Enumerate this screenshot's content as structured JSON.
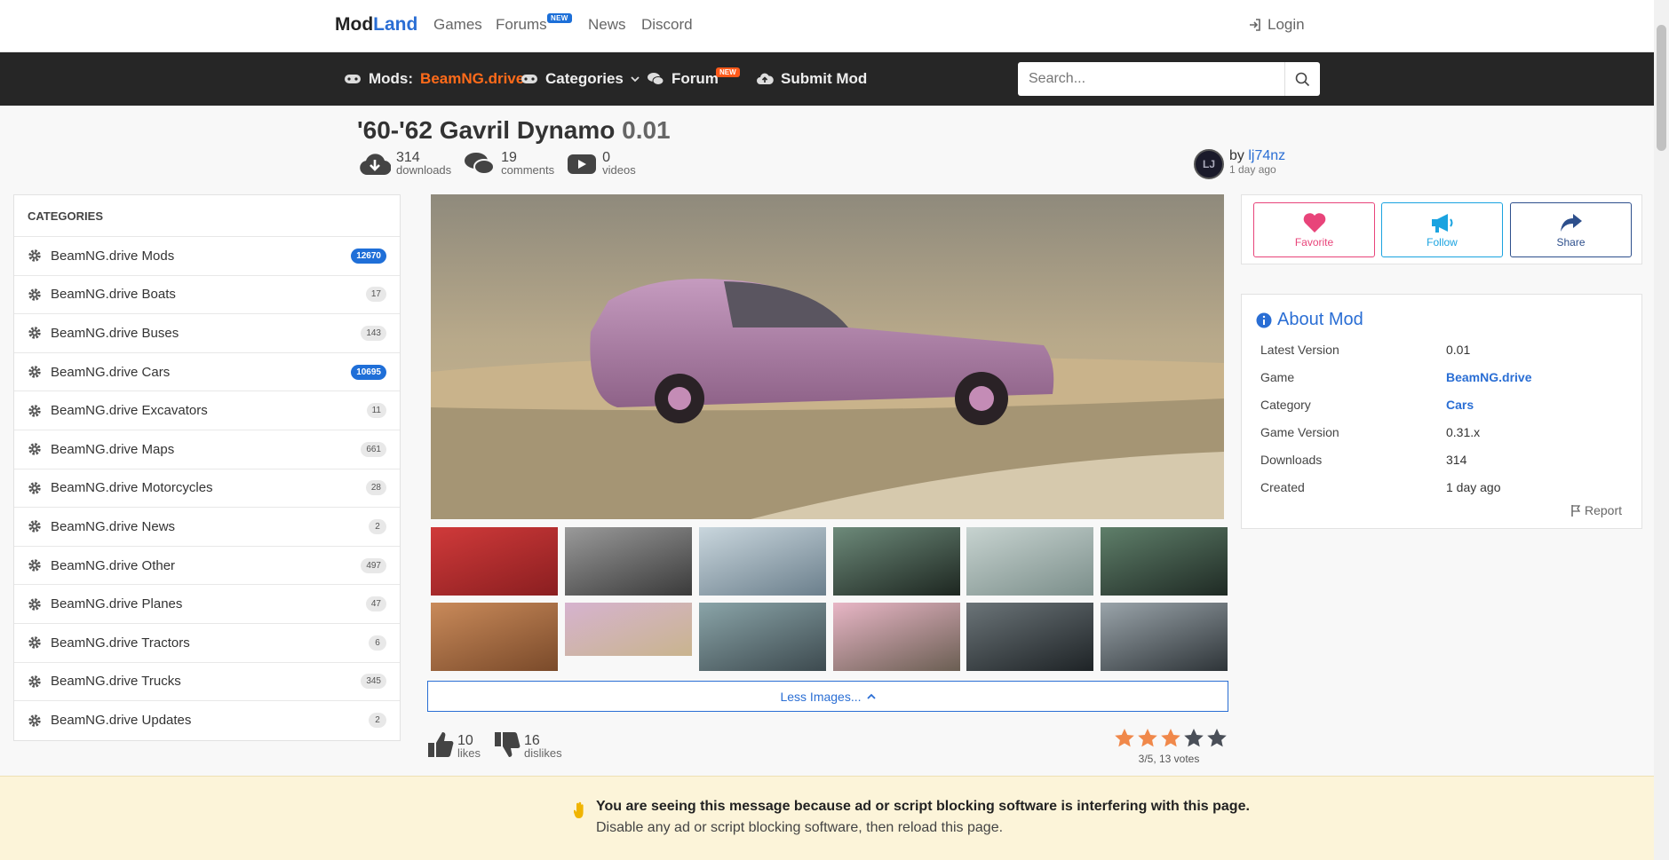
{
  "nav": {
    "logo_mod": "Mod",
    "logo_land": "Land",
    "games": "Games",
    "forums": "Forums",
    "forums_badge": "NEW",
    "news": "News",
    "discord": "Discord",
    "login": "Login"
  },
  "subnav": {
    "mods_label": "Mods:",
    "mods_game": "BeamNG.drive",
    "categories": "Categories",
    "forum": "Forum",
    "forum_badge": "NEW",
    "submit": "Submit Mod",
    "search_placeholder": "Search..."
  },
  "mod": {
    "title": "'60-'62 Gavril Dynamo",
    "version": "0.01",
    "downloads": "314",
    "downloads_label": "downloads",
    "comments": "19",
    "comments_label": "comments",
    "videos": "0",
    "videos_label": "videos",
    "by": "by",
    "author": "lj74nz",
    "posted": "1 day ago"
  },
  "sidebar": {
    "heading": "CATEGORIES",
    "items": [
      {
        "label": "BeamNG.drive Mods",
        "count": "12670",
        "highlight": true
      },
      {
        "label": "BeamNG.drive Boats",
        "count": "17",
        "highlight": false
      },
      {
        "label": "BeamNG.drive Buses",
        "count": "143",
        "highlight": false
      },
      {
        "label": "BeamNG.drive Cars",
        "count": "10695",
        "highlight": true
      },
      {
        "label": "BeamNG.drive Excavators",
        "count": "11",
        "highlight": false
      },
      {
        "label": "BeamNG.drive Maps",
        "count": "661",
        "highlight": false
      },
      {
        "label": "BeamNG.drive Motorcycles",
        "count": "28",
        "highlight": false
      },
      {
        "label": "BeamNG.drive News",
        "count": "2",
        "highlight": false
      },
      {
        "label": "BeamNG.drive Other",
        "count": "497",
        "highlight": false
      },
      {
        "label": "BeamNG.drive Planes",
        "count": "47",
        "highlight": false
      },
      {
        "label": "BeamNG.drive Tractors",
        "count": "6",
        "highlight": false
      },
      {
        "label": "BeamNG.drive Trucks",
        "count": "345",
        "highlight": false
      },
      {
        "label": "BeamNG.drive Updates",
        "count": "2",
        "highlight": false
      }
    ]
  },
  "gallery": {
    "less_images": "Less Images..."
  },
  "feedback": {
    "likes": "10",
    "likes_label": "likes",
    "dislikes": "16",
    "dislikes_label": "dislikes",
    "rating_value": 3,
    "rating_max": 5,
    "rating_text": "3/5, 13 votes"
  },
  "actions": {
    "favorite": "Favorite",
    "follow": "Follow",
    "share": "Share"
  },
  "about": {
    "heading": "About Mod",
    "rows": [
      {
        "label": "Latest Version",
        "value": "0.01",
        "link": false
      },
      {
        "label": "Game",
        "value": "BeamNG.drive",
        "link": true
      },
      {
        "label": "Category",
        "value": "Cars",
        "link": true
      },
      {
        "label": "Game Version",
        "value": "0.31.x",
        "link": false
      },
      {
        "label": "Downloads",
        "value": "314",
        "link": false
      },
      {
        "label": "Created",
        "value": "1 day ago",
        "link": false
      }
    ],
    "report": "Report"
  },
  "adblock": {
    "line1": "You are seeing this message because ad or script blocking software is interfering with this page.",
    "line2": "Disable any ad or script blocking software, then reload this page."
  },
  "colors": {
    "brand_blue": "#2a6ed4",
    "accent_orange": "#ff6b1a",
    "favorite_pink": "#e8447a",
    "follow_cyan": "#1aa3e0",
    "share_navy": "#2d4f8c",
    "star_orange": "#f0884a"
  }
}
